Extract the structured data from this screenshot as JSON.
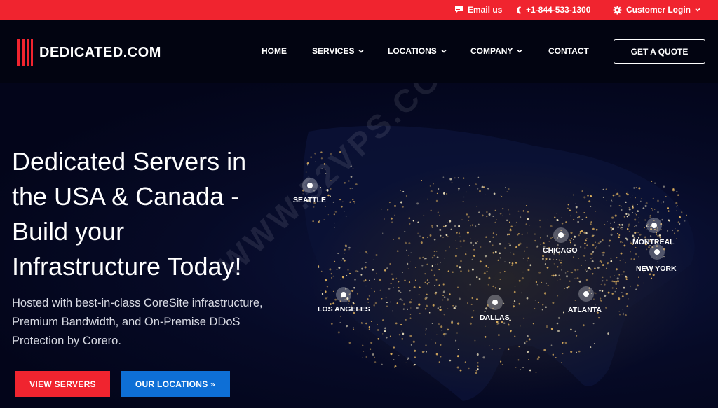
{
  "topbar": {
    "email_label": "Email us",
    "phone_label": "+1-844-533-1300",
    "login_label": "Customer Login"
  },
  "brand": {
    "name": "DEDICATED.COM",
    "accent_color": "#f0242f",
    "secondary_color": "#0e6fd6"
  },
  "nav": {
    "items": [
      {
        "label": "HOME",
        "dropdown": false
      },
      {
        "label": "SERVICES",
        "dropdown": true
      },
      {
        "label": "LOCATIONS",
        "dropdown": true
      },
      {
        "label": "COMPANY",
        "dropdown": true
      },
      {
        "label": "CONTACT",
        "dropdown": false
      }
    ],
    "cta_label": "GET A QUOTE"
  },
  "hero": {
    "title_lines": [
      "Dedicated Servers in",
      "the USA & Canada -",
      "Build your",
      "Infrastructure Today!"
    ],
    "subtitle_lines": [
      "Hosted with best-in-class CoreSite infrastructure,",
      "Premium Bandwidth, and On-Premise DDoS",
      "Protection by Corero."
    ],
    "primary_button": "VIEW SERVERS",
    "secondary_button": "OUR LOCATIONS »"
  },
  "watermark": "WWW.52VPS.COM",
  "cities": [
    "SEATTLE",
    "LOS ANGELES",
    "DALLAS",
    "CHICAGO",
    "ATLANTA",
    "MONTREAL",
    "NEW YORK"
  ],
  "icons": [
    "chat-icon",
    "phone-icon",
    "gear-icon",
    "chevron-down-icon",
    "logo-bars-icon",
    "double-chevron-icon"
  ]
}
